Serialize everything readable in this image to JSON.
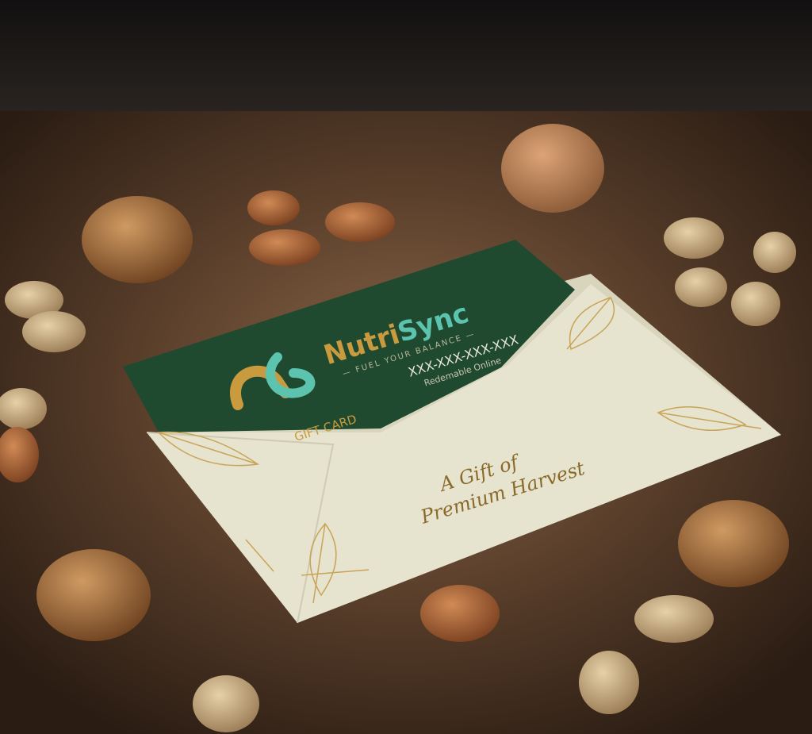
{
  "card": {
    "brand_part1": "Nutri",
    "brand_part2": "Sync",
    "tagline": "— FUEL YOUR BALANCE —",
    "label": "GIFT CARD",
    "code": "XXX-XXX-XXX-XXX",
    "redeem": "Redemable Online"
  },
  "envelope": {
    "line1": "A Gift of",
    "line2": "Premium Harvest"
  },
  "colors": {
    "card_green": "#1f4a30",
    "gold": "#c99a3e",
    "teal": "#5cc4ae",
    "envelope": "#e6e3cf",
    "wood": "#4a3323"
  }
}
